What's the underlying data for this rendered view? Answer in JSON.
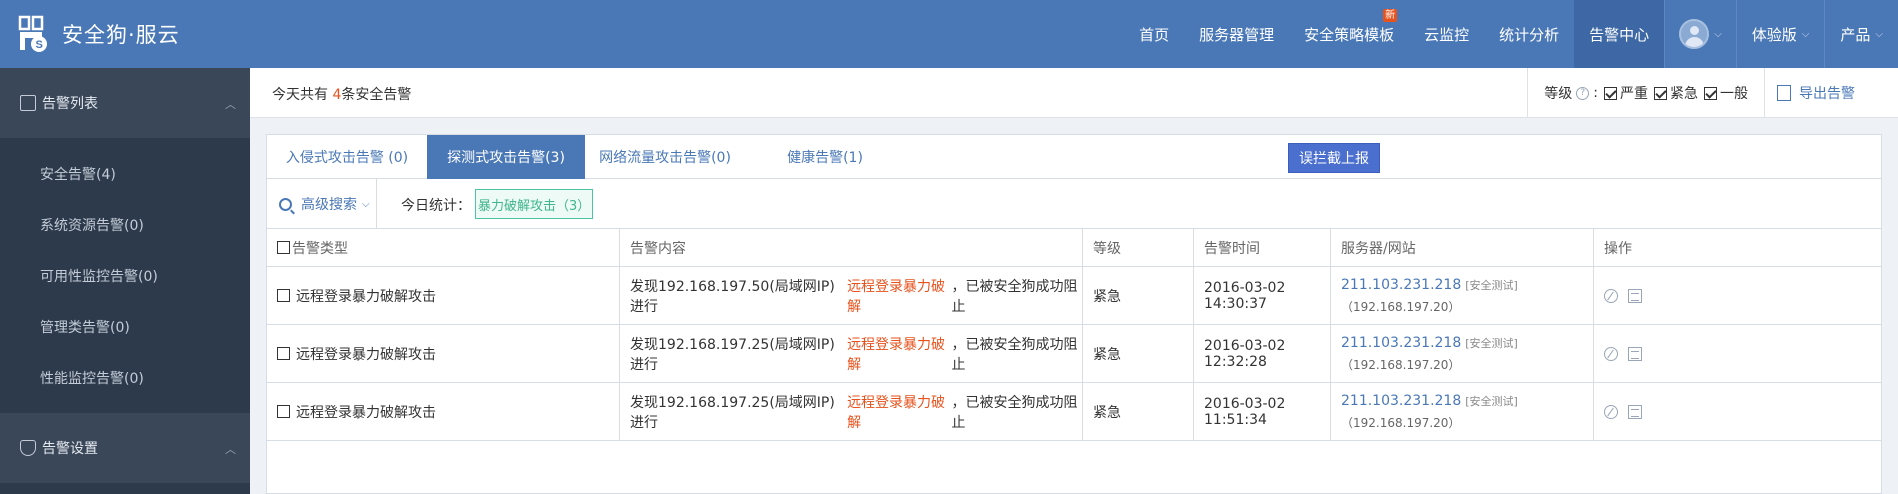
{
  "app": {
    "brand": "安全狗·服云"
  },
  "nav": {
    "items": [
      "首页",
      "服务器管理",
      "安全策略模板",
      "云监控",
      "统计分析",
      "告警中心"
    ],
    "new_badge": "新",
    "trial": "体验版",
    "product": "产品"
  },
  "sidebar": {
    "group1": "告警列表",
    "items": [
      "安全告警(4)",
      "系统资源告警(0)",
      "可用性监控告警(0)",
      "管理类告警(0)",
      "性能监控告警(0)"
    ],
    "group2": "告警设置"
  },
  "summary": {
    "prefix": "今天共有 ",
    "count": "4",
    "suffix": "条安全告警",
    "level_label": "等级",
    "level_options": [
      "严重",
      "紧急",
      "一般"
    ],
    "export": "导出告警"
  },
  "tabs": [
    "入侵式攻击告警 (0)",
    "探测式攻击告警(3)",
    "网络流量攻击告警(0)",
    "健康告警(1)"
  ],
  "report_button": "误拦截上报",
  "filters": {
    "advanced_search": "高级搜索",
    "today_label": "今日统计：",
    "stat_tag": "暴力破解攻击（3）"
  },
  "table": {
    "headers": [
      "告警类型",
      "告警内容",
      "等级",
      "告警时间",
      "服务器/网站",
      "操作"
    ],
    "rows": [
      {
        "type": "远程登录暴力破解攻击",
        "content_pre": "发现192.168.197.50(局域网IP)进行",
        "content_hl": "远程登录暴力破解",
        "content_post": "，已被安全狗成功阻止",
        "level": "紧急",
        "time": "2016-03-02 14:30:37",
        "server_ip": "211.103.231.218",
        "server_tag": "[安全测试]",
        "server_local": "（192.168.197.20）"
      },
      {
        "type": "远程登录暴力破解攻击",
        "content_pre": "发现192.168.197.25(局域网IP)进行",
        "content_hl": "远程登录暴力破解",
        "content_post": "，已被安全狗成功阻止",
        "level": "紧急",
        "time": "2016-03-02 12:32:28",
        "server_ip": "211.103.231.218",
        "server_tag": "[安全测试]",
        "server_local": "（192.168.197.20）"
      },
      {
        "type": "远程登录暴力破解攻击",
        "content_pre": "发现192.168.197.25(局域网IP)进行",
        "content_hl": "远程登录暴力破解",
        "content_post": "，已被安全狗成功阻止",
        "level": "紧急",
        "time": "2016-03-02 11:51:34",
        "server_ip": "211.103.231.218",
        "server_tag": "[安全测试]",
        "server_local": "（192.168.197.20）"
      }
    ]
  },
  "colors": {
    "topbar": "#4a78b7",
    "sidebar": "#2d3a4b",
    "accent": "#4a78b7",
    "highlight": "#e8531d",
    "stat_tag": "#3fb68e"
  },
  "icons": [
    "logo-icon",
    "avatar-icon",
    "list-icon",
    "shield-icon",
    "question-icon",
    "export-icon",
    "search-icon",
    "chevron-down-icon",
    "ignore-icon",
    "detail-icon"
  ]
}
